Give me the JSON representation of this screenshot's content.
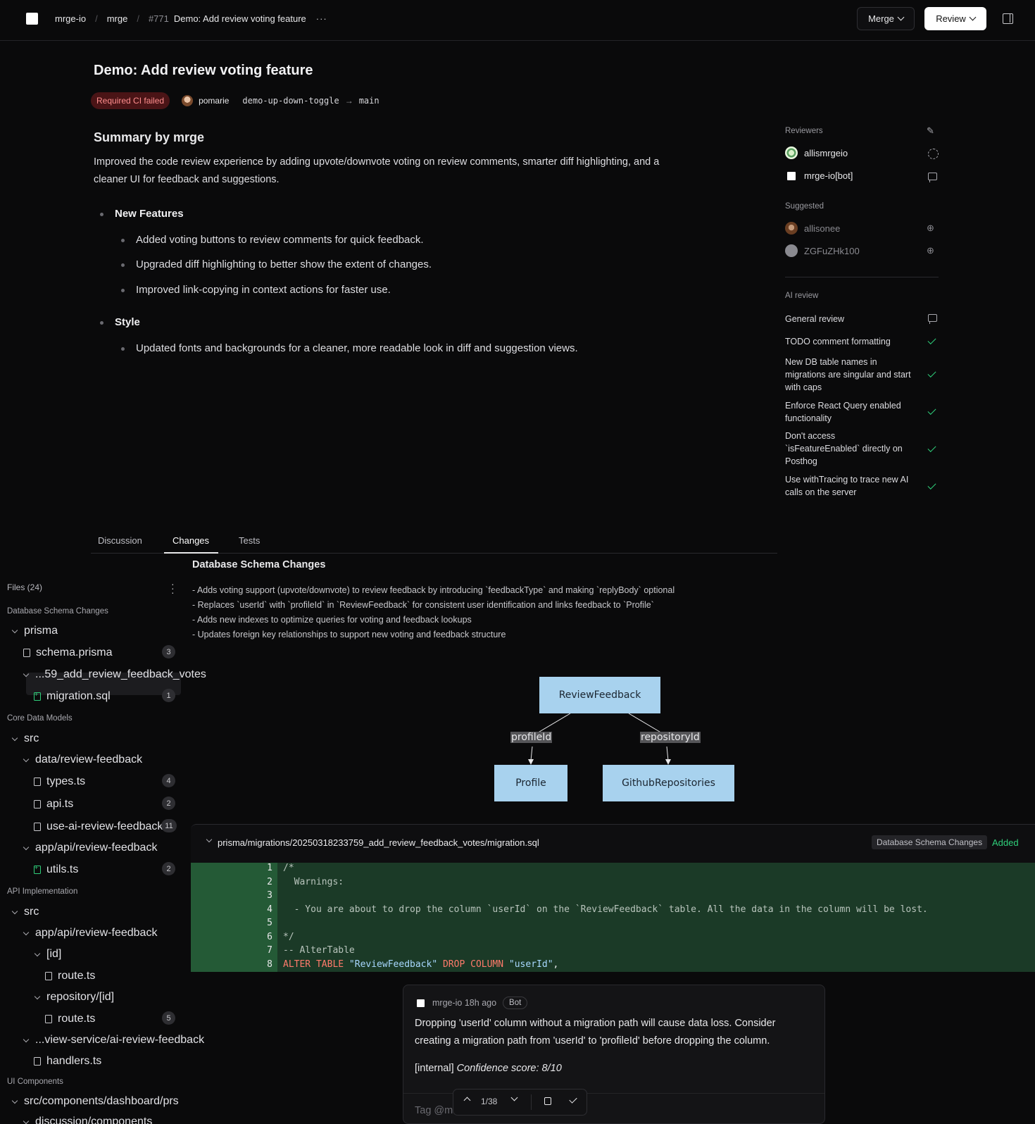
{
  "topbar": {
    "org": "mrge-io",
    "repo": "mrge",
    "pr_number": "#771",
    "pr_title": "Demo: Add review voting feature",
    "more": "···",
    "merge_label": "Merge",
    "review_label": "Review"
  },
  "header": {
    "title": "Demo: Add review voting feature",
    "ci_status": "Required CI failed",
    "author": "pomarie",
    "source_branch": "demo-up-down-toggle",
    "arrow": "→",
    "target_branch": "main"
  },
  "summary": {
    "heading": "Summary by mrge",
    "text": "Improved the code review experience by adding upvote/downvote voting on review comments, smarter diff highlighting, and a cleaner UI for feedback and suggestions.",
    "sections": [
      {
        "title": "New Features",
        "items": [
          "Added voting buttons to review comments for quick feedback.",
          "Upgraded diff highlighting to better show the extent of changes.",
          "Improved link-copying in context actions for faster use."
        ]
      },
      {
        "title": "Style",
        "items": [
          "Updated fonts and backgrounds for a cleaner, more readable look in diff and suggestion views."
        ]
      }
    ]
  },
  "sidebar": {
    "reviewers_label": "Reviewers",
    "reviewers": [
      "allismrgeio",
      "mrge-io[bot]"
    ],
    "suggested_label": "Suggested",
    "suggested": [
      "allisonee",
      "ZGFuZHk100"
    ],
    "ai_review_label": "AI review",
    "ai_rules": [
      "General review",
      "TODO comment formatting",
      "New DB table names in migrations are singular and start with caps",
      "Enforce React Query enabled functionality",
      "Don't access `isFeatureEnabled` directly on Posthog",
      "Use withTracing to trace new AI calls on the server"
    ]
  },
  "tabs": [
    "Discussion",
    "Changes",
    "Tests"
  ],
  "files": {
    "header": "Files (24)",
    "groups": [
      "Database Schema Changes",
      "Core Data Models",
      "API Implementation",
      "UI Components"
    ],
    "items": {
      "prisma": "prisma",
      "schema": "schema.prisma",
      "schema_count": "3",
      "migration_dir": "...59_add_review_feedback_votes",
      "migration": "migration.sql",
      "migration_count": "1",
      "src1": "src",
      "data_dir": "data/review-feedback",
      "types": "types.ts",
      "types_count": "4",
      "api": "api.ts",
      "api_count": "2",
      "use_ai": "use-ai-review-feedback.ts",
      "use_ai_count": "11",
      "app_api1": "app/api/review-feedback",
      "utils": "utils.ts",
      "utils_count": "2",
      "src2": "src",
      "app_api2": "app/api/review-feedback",
      "id_dir": "[id]",
      "route1": "route.ts",
      "repo_dir": "repository/[id]",
      "route2": "route.ts",
      "route2_count": "5",
      "view_service": "...view-service/ai-review-feedback",
      "handlers": "handlers.ts",
      "components_dir": "src/components/dashboard/prs",
      "discussion_dir": "discussion/components"
    }
  },
  "changes": {
    "heading": "Database Schema Changes",
    "items": [
      "- Adds voting support (upvote/downvote) to review feedback by introducing `feedbackType` and making `replyBody` optional",
      "- Replaces `userId` with `profileId` in `ReviewFeedback` for consistent user identification and links feedback to `Profile`",
      "- Adds new indexes to optimize queries for voting and feedback lookups",
      "- Updates foreign key relationships to support new voting and feedback structure"
    ],
    "diagram": {
      "nodes": [
        "ReviewFeedback",
        "Profile",
        "GithubRepositories"
      ],
      "edges": [
        "profileId",
        "repositoryId"
      ]
    }
  },
  "diff": {
    "path": "prisma/migrations/20250318233759_add_review_feedback_votes/migration.sql",
    "tag": "Database Schema Changes",
    "status": "Added",
    "lines": [
      {
        "n": "1",
        "text": "/*"
      },
      {
        "n": "2",
        "text": "  Warnings:"
      },
      {
        "n": "3",
        "text": ""
      },
      {
        "n": "4",
        "text": "  - You are about to drop the column `userId` on the `ReviewFeedback` table. All the data in the column will be lost."
      },
      {
        "n": "5",
        "text": ""
      },
      {
        "n": "6",
        "text": "*/"
      },
      {
        "n": "7",
        "text": "-- AlterTable"
      },
      {
        "n": "8",
        "kw1": "ALTER TABLE",
        "s1": "\"ReviewFeedback\"",
        "kw2": "DROP COLUMN",
        "s2": "\"userId\"",
        "end": ","
      }
    ]
  },
  "comment": {
    "author": "mrge-io",
    "time": "18h ago",
    "badge": "Bot",
    "body": "Dropping 'userId' column without a migration path will cause data loss. Consider creating a migration path from 'userId' to 'profileId' before dropping the column.",
    "internal": "[internal]",
    "confidence": "Confidence score: 8/10",
    "input_placeholder": "Tag @mrge-io to give feedback...",
    "nav": "1/38"
  }
}
